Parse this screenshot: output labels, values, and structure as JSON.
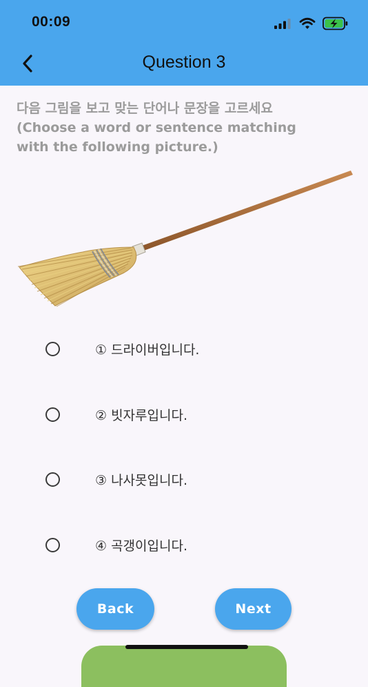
{
  "status_bar": {
    "time": "00:09",
    "icons": [
      "signal-icon",
      "wifi-icon",
      "battery-charging-icon"
    ]
  },
  "header": {
    "title": "Question 3",
    "back_icon": "chevron-left-icon"
  },
  "question": {
    "instruction_korean": "다음 그림을 보고 맞는 단어나 문장을 고르세요",
    "instruction_english_line1": "(Choose a word or sentence matching",
    "instruction_english_line2": "with the following picture.)",
    "image": "broom-illustration"
  },
  "options": [
    {
      "label": "① 드라이버입니다.",
      "selected": false
    },
    {
      "label": "② 빗자루입니다.",
      "selected": false
    },
    {
      "label": "③ 나사못입니다.",
      "selected": false
    },
    {
      "label": "④ 곡갱이입니다.",
      "selected": false
    }
  ],
  "buttons": {
    "back_label": "Back",
    "next_label": "Next"
  },
  "colors": {
    "accent": "#4aa6ed",
    "background": "#f9f6fb",
    "instruction_text": "#9b9b9b",
    "bottom_bar": "#8cbf5f"
  }
}
